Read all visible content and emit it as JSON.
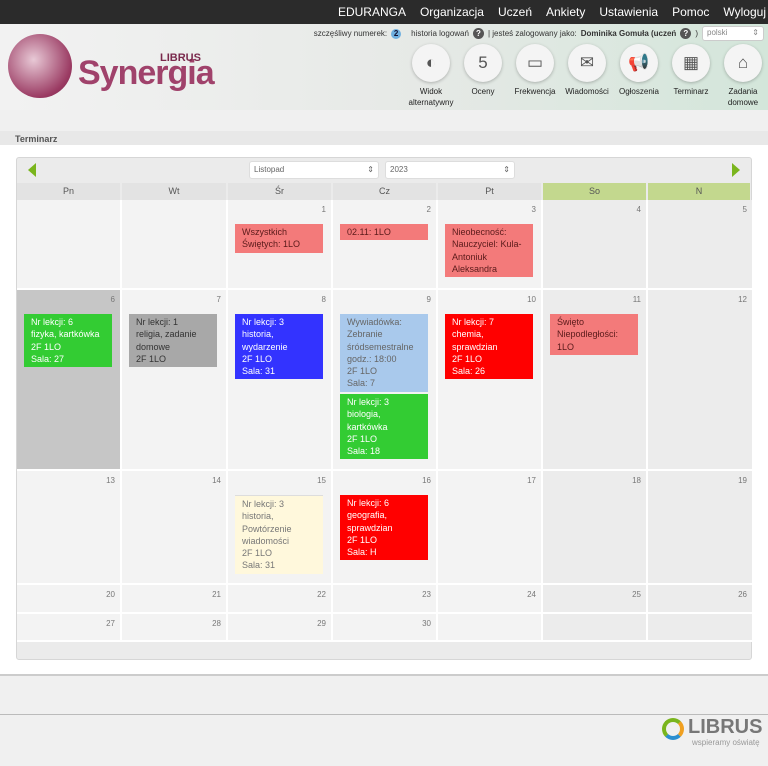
{
  "topnav": [
    "EDURANGA",
    "Organizacja",
    "Uczeń",
    "Ankiety",
    "Ustawienia",
    "Pomoc",
    "Wyloguj"
  ],
  "logo": {
    "name": "Synergia",
    "sub": "LIBRUS"
  },
  "info": {
    "lucky_label": "szczęśliwy numerek:",
    "lucky": "2",
    "history": "historia logowań",
    "logged": "| jesteś zalogowany jako:",
    "user": "Dominika Gomuła (uczeń",
    "close": ")",
    "lang": "polski"
  },
  "nav": [
    {
      "label": "Widok alternatywny",
      "icon": "◐"
    },
    {
      "label": "Oceny",
      "icon": "5"
    },
    {
      "label": "Frekwencja",
      "icon": "▭"
    },
    {
      "label": "Wiadomości",
      "icon": "✉"
    },
    {
      "label": "Ogłoszenia",
      "icon": "📢"
    },
    {
      "label": "Terminarz",
      "icon": "▦"
    },
    {
      "label": "Zadania domowe",
      "icon": "⌂"
    }
  ],
  "panel_title": "Terminarz",
  "month": "Listopad",
  "year": "2023",
  "days": [
    "Pn",
    "Wt",
    "Śr",
    "Cz",
    "Pt",
    "So",
    "N"
  ],
  "weeks": [
    [
      "",
      "",
      "1",
      "2",
      "3",
      "4",
      "5"
    ],
    [
      "6",
      "7",
      "8",
      "9",
      "10",
      "11",
      "12"
    ],
    [
      "13",
      "14",
      "15",
      "16",
      "17",
      "18",
      "19"
    ],
    [
      "20",
      "21",
      "22",
      "23",
      "24",
      "25",
      "26"
    ],
    [
      "27",
      "28",
      "29",
      "30",
      "",
      "",
      ""
    ]
  ],
  "events": [
    {
      "week": 0,
      "day": 2,
      "text": "Wszystkich\nŚwiętych: 1LO",
      "color": "#f37a7a",
      "fg": "#5a1a1a"
    },
    {
      "week": 0,
      "day": 3,
      "text": "02.11: 1LO",
      "color": "#f37a7a",
      "fg": "#5a1a1a"
    },
    {
      "week": 0,
      "day": 4,
      "text": "Nieobecność:\nNauczyciel: Kula-\nAntoniuk\nAleksandra",
      "color": "#f37a7a",
      "fg": "#5a1a1a"
    },
    {
      "week": 1,
      "day": 0,
      "text": "Nr lekcji: 6\nfizyka, kartkówka\n2F 1LO\nSala: 27",
      "color": "#33cc33",
      "fg": "#fff"
    },
    {
      "week": 1,
      "day": 1,
      "text": "Nr lekcji: 1\nreligia, zadanie\ndomowe\n2F 1LO",
      "color": "#a8a8a8",
      "fg": "#333"
    },
    {
      "week": 1,
      "day": 2,
      "text": "Nr lekcji: 3\nhistoria,\nwydarzenie\n2F 1LO\nSala: 31",
      "color": "#3333ff",
      "fg": "#fff"
    },
    {
      "week": 1,
      "day": 3,
      "text": "Wywiadówka:\nZebranie\nśródsemestralne\ngodz.: 18:00\n2F 1LO\nSala: 7",
      "color": "#a9c9ec",
      "fg": "#666"
    },
    {
      "week": 1,
      "day": 3,
      "slot": 1,
      "text": "Nr lekcji: 3\nbiologia,\nkartkówka\n2F 1LO\nSala: 18",
      "color": "#33cc33",
      "fg": "#fff"
    },
    {
      "week": 1,
      "day": 4,
      "text": "Nr lekcji: 7\nchemia,\nsprawdzian\n2F 1LO\nSala: 26",
      "color": "#ff0000",
      "fg": "#fff"
    },
    {
      "week": 1,
      "day": 5,
      "text": "Święto\nNiepodległości:\n1LO",
      "color": "#f37a7a",
      "fg": "#5a1a1a"
    },
    {
      "week": 2,
      "day": 2,
      "text": "Nr lekcji: 3\nhistoria,\nPowtórzenie\nwiadomości\n2F 1LO\nSala: 31",
      "color": "#fff8dc",
      "fg": "#777"
    },
    {
      "week": 2,
      "day": 3,
      "text": "Nr lekcji: 6\ngeografia,\nsprawdzian\n2F 1LO\nSala: H",
      "color": "#ff0000",
      "fg": "#fff"
    }
  ],
  "footer": {
    "brand": "LIBRUS",
    "tagline": "wspieramy oświatę"
  }
}
